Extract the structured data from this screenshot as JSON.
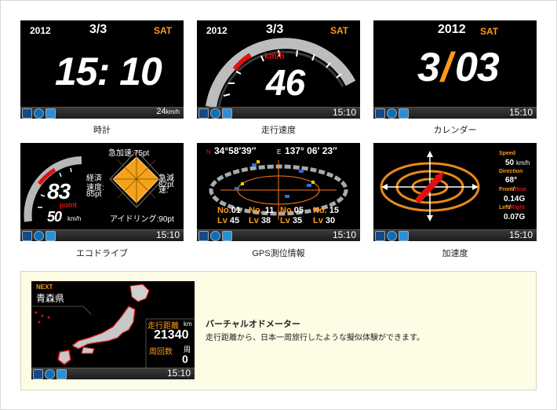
{
  "status": {
    "time": "15:10"
  },
  "clock": {
    "year": "2012",
    "date": "3/3",
    "day": "SAT",
    "time": "15: 10",
    "speed": "24",
    "speed_unit": "km/h",
    "caption": "時計"
  },
  "speed": {
    "year": "2012",
    "date": "3/3",
    "day": "SAT",
    "unit": "km/h",
    "value": "46",
    "time": "15:10",
    "caption": "走行速度"
  },
  "calendar": {
    "year": "2012",
    "day": "SAT",
    "month": "3",
    "slash": "/",
    "date": "03",
    "time": "15:10",
    "caption": "カレンダー"
  },
  "eco": {
    "accel": "急加速:75pt",
    "decel_label": "急減速:",
    "decel_value": "82pt",
    "econ_label1": "経済",
    "econ_label2": "速度:",
    "econ_value": "85pt",
    "idle": "アイドリング:90pt",
    "score": "83",
    "score_unit": "point",
    "speed": "50",
    "speed_unit": "km/h",
    "time": "15:10",
    "caption": "エコドライブ"
  },
  "gps": {
    "n_label": "N",
    "n_coord": "34°58′39″",
    "e_label": "E",
    "e_coord": "137° 06′ 23″",
    "sats": [
      {
        "no_label": "No.",
        "no": "01",
        "lv_label": "Lv",
        "lv": "45"
      },
      {
        "no_label": "No.",
        "no": "11",
        "lv_label": "Lv",
        "lv": "38"
      },
      {
        "no_label": "No.",
        "no": "05",
        "lv_label": "Lv",
        "lv": "35"
      },
      {
        "no_label": "No.",
        "no": "15",
        "lv_label": "Lv",
        "lv": "30"
      }
    ],
    "time": "15:10",
    "caption": "GPS測位情報"
  },
  "accel": {
    "speed_label": "Speed",
    "speed_value": "50",
    "speed_unit": "km/h",
    "direction_label": "Direction",
    "direction_value": "68°",
    "front_label": "Front",
    "rear_label": "Rear",
    "slash": "/",
    "front_value": "0.14G",
    "left_label": "Left",
    "right_label": "Right",
    "lr_value": "0.07G",
    "time": "15:10",
    "caption": "加速度"
  },
  "odo": {
    "next_label": "NEXT",
    "prefecture": "青森県",
    "distance_label": "走行距離",
    "distance_unit": "km",
    "distance_value": "21340",
    "laps_label": "周回数",
    "laps_unit": "周",
    "laps_value": "0",
    "time": "15:10",
    "title": "バーチャルオドメーター",
    "description": "走行距離から、日本一周旅行したような擬似体験ができます。"
  },
  "colors": {
    "accent": "#ff9a1a",
    "red": "#e01010",
    "screen_bg": "#000000"
  }
}
